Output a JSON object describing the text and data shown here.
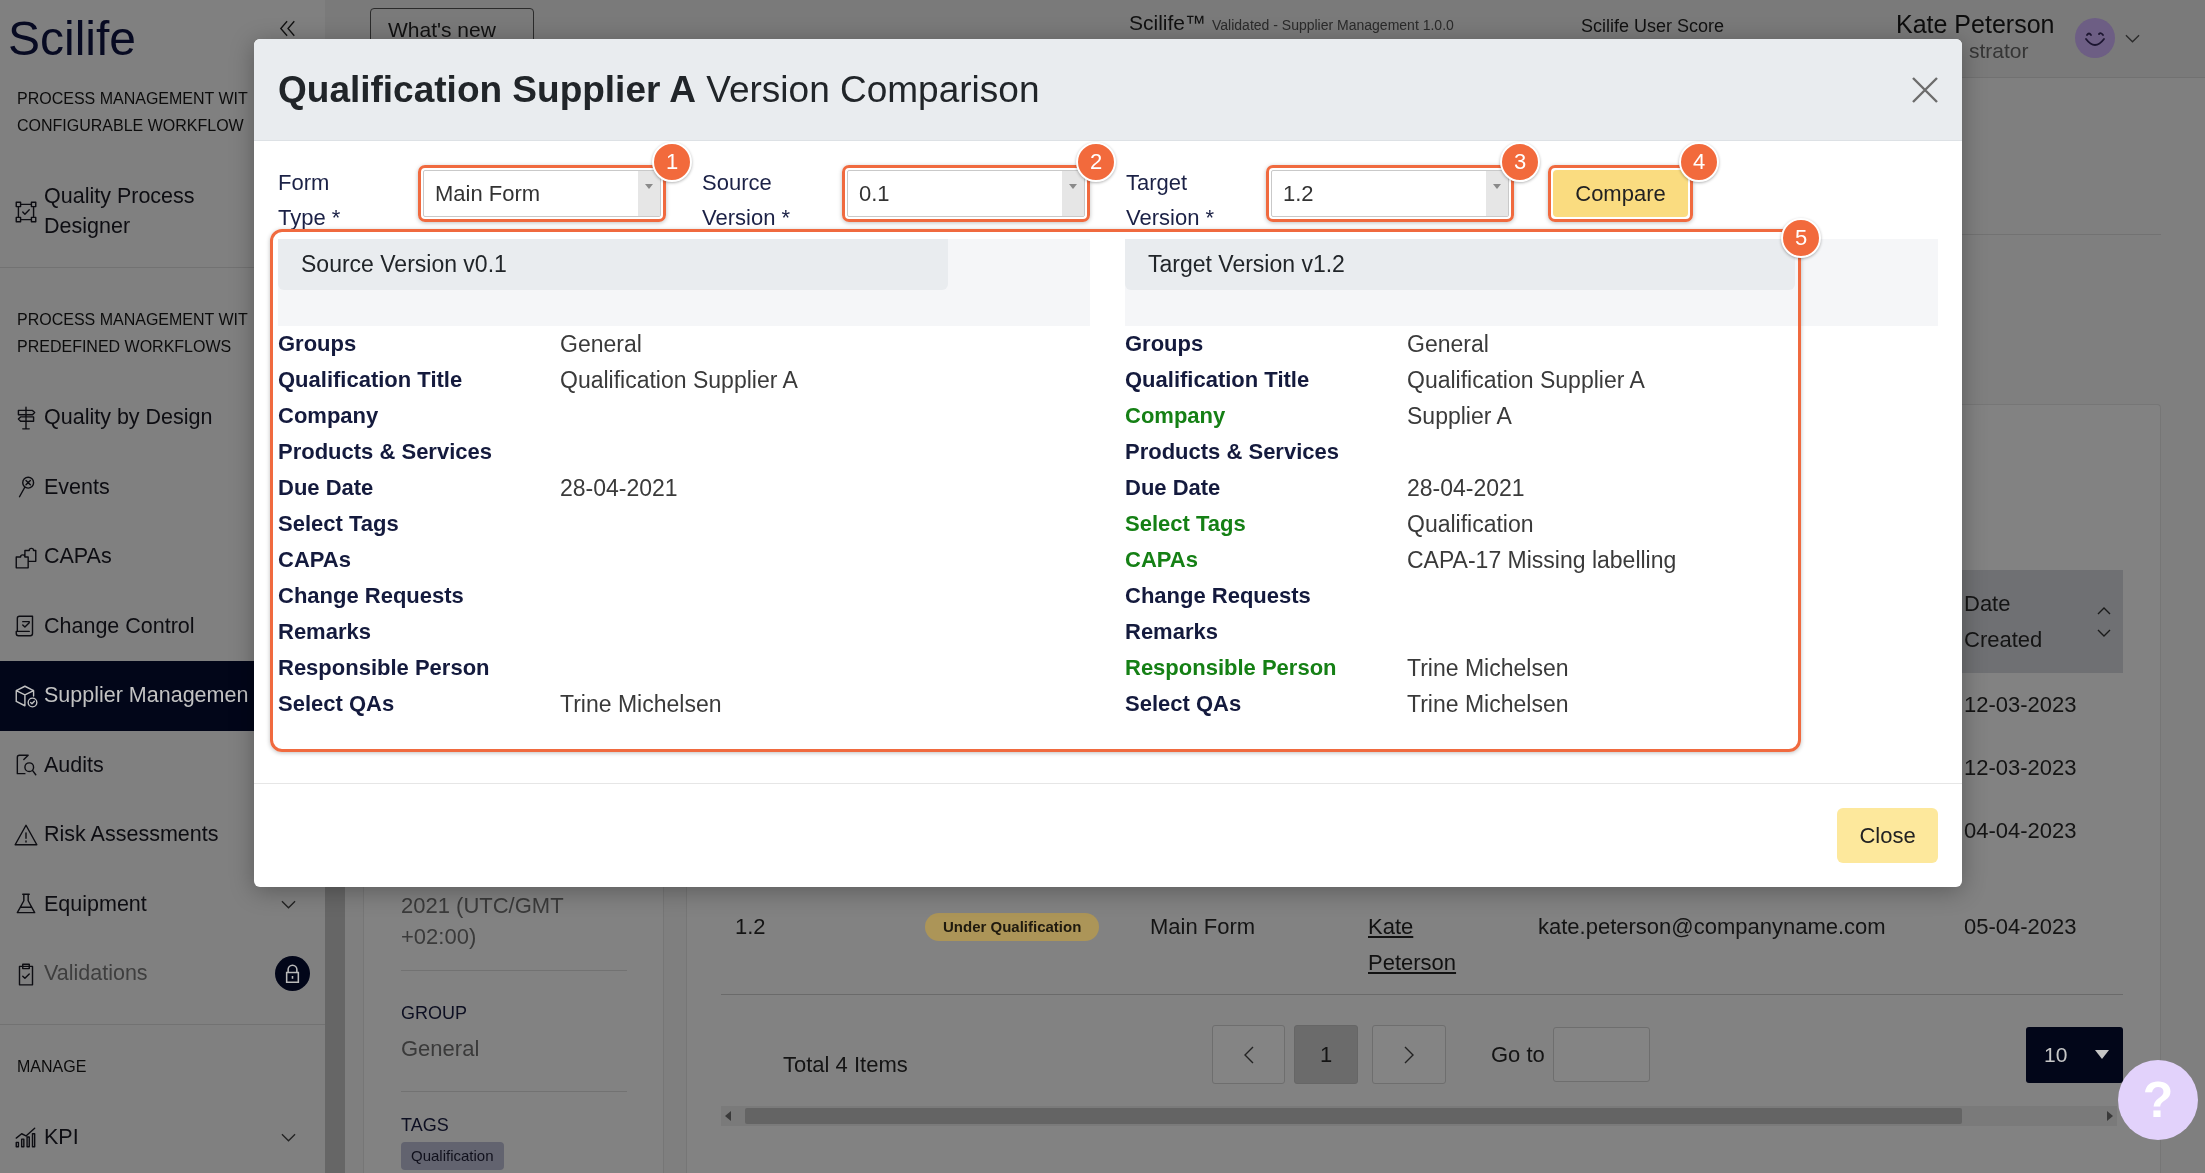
{
  "sidebar": {
    "logo": "Scilife",
    "sections": [
      {
        "heading": [
          "PROCESS MANAGEMENT WIT",
          "CONFIGURABLE WORKFLOW"
        ],
        "items": [
          {
            "label": "Quality Process Designer",
            "kind": "link",
            "selected": false
          }
        ]
      },
      {
        "heading": [
          "PROCESS MANAGEMENT WIT",
          "PREDEFINED WORKFLOWS"
        ],
        "items": [
          {
            "label": "Quality by Design",
            "kind": "link",
            "selected": false
          },
          {
            "label": "Events",
            "kind": "link",
            "selected": false
          },
          {
            "label": "CAPAs",
            "kind": "link",
            "selected": false
          },
          {
            "label": "Change Control",
            "kind": "link",
            "selected": false
          },
          {
            "label": "Supplier Managemen",
            "kind": "link",
            "selected": true
          },
          {
            "label": "Audits",
            "kind": "link",
            "selected": false
          },
          {
            "label": "Risk Assessments",
            "kind": "link",
            "selected": false
          },
          {
            "label": "Equipment",
            "kind": "group",
            "selected": false
          },
          {
            "label": "Validations",
            "kind": "locked",
            "selected": false
          }
        ]
      },
      {
        "heading": [
          "MANAGE"
        ],
        "items": [
          {
            "label": "KPI",
            "kind": "group",
            "selected": false
          }
        ]
      }
    ]
  },
  "top_bar": {
    "whats_new_button": "What's new",
    "product_name": "Scilife™",
    "product_version": "Validated - Supplier Management 1.0.0",
    "score_label": "Scilife User Score",
    "user_name": "Kate Peterson",
    "user_role": "strator"
  },
  "record_panel": {
    "date_lines": [
      "2021 (UTC/GMT",
      "+02:00)"
    ],
    "group_label": "GROUP",
    "group_value": "General",
    "tags_label": "TAGS",
    "tags": [
      "Qualification"
    ]
  },
  "records_table": {
    "date_column": "Date Created",
    "rows": [
      {
        "date_created": "12-03-2023"
      },
      {
        "date_created": "12-03-2023"
      },
      {
        "date_created": "04-04-2023"
      },
      {
        "column_1": "1.2",
        "column_2": "Under Qualification",
        "column_3": "Main Form",
        "column_4": "Kate Peterson",
        "column_5": "kate.peterson@companyname.com",
        "date_created": "05-04-2023"
      }
    ],
    "pagination": {
      "total": "Total 4 Items",
      "pages": [
        {
          "label": "1",
          "selected": true
        }
      ],
      "go_to_label": "Go to",
      "page_size": "10"
    }
  },
  "dialog": {
    "title": "**Qualification Supplier A** Version Comparison",
    "form": {
      "fields": [
        {
          "label": "Form Type *",
          "value": "Main Form",
          "callout": "1"
        },
        {
          "label": "Source Version *",
          "value": "0.1",
          "callout": "2"
        },
        {
          "label": "Target Version *",
          "value": "1.2",
          "callout": "3"
        }
      ],
      "compare_button": {
        "label": "Compare",
        "callout": "4"
      }
    },
    "comparison": {
      "callout": "5",
      "panels": [
        {
          "title": "Source Version v0.1",
          "rows": [
            {
              "label": "Groups",
              "value": "General",
              "changed": false
            },
            {
              "label": "Qualification Title",
              "value": "Qualification Supplier A",
              "changed": false
            },
            {
              "label": "Company",
              "changed": false
            },
            {
              "label": "Products & Services",
              "changed": false
            },
            {
              "label": "Due Date",
              "value": "28-04-2021",
              "changed": false
            },
            {
              "label": "Select Tags",
              "changed": false
            },
            {
              "label": "CAPAs",
              "changed": false
            },
            {
              "label": "Change Requests",
              "changed": false
            },
            {
              "label": "Remarks",
              "changed": false
            },
            {
              "label": "Responsible Person",
              "changed": false
            },
            {
              "label": "Select QAs",
              "value": "Trine Michelsen",
              "changed": false
            }
          ]
        },
        {
          "title": "Target Version v1.2",
          "rows": [
            {
              "label": "Groups",
              "value": "General",
              "changed": false
            },
            {
              "label": "Qualification Title",
              "value": "Qualification Supplier A",
              "changed": false
            },
            {
              "label": "Company",
              "value": "Supplier A",
              "changed": true
            },
            {
              "label": "Products & Services",
              "changed": false
            },
            {
              "label": "Due Date",
              "value": "28-04-2021",
              "changed": false
            },
            {
              "label": "Select Tags",
              "value": "Qualification",
              "changed": true
            },
            {
              "label": "CAPAs",
              "value": "CAPA-17 Missing labelling",
              "changed": true
            },
            {
              "label": "Change Requests",
              "changed": false
            },
            {
              "label": "Remarks",
              "changed": false
            },
            {
              "label": "Responsible Person",
              "value": "Trine Michelsen",
              "changed": true
            },
            {
              "label": "Select QAs",
              "value": "Trine Michelsen",
              "changed": false
            }
          ]
        }
      ]
    },
    "close_button": "Close"
  },
  "help_button": "?"
}
